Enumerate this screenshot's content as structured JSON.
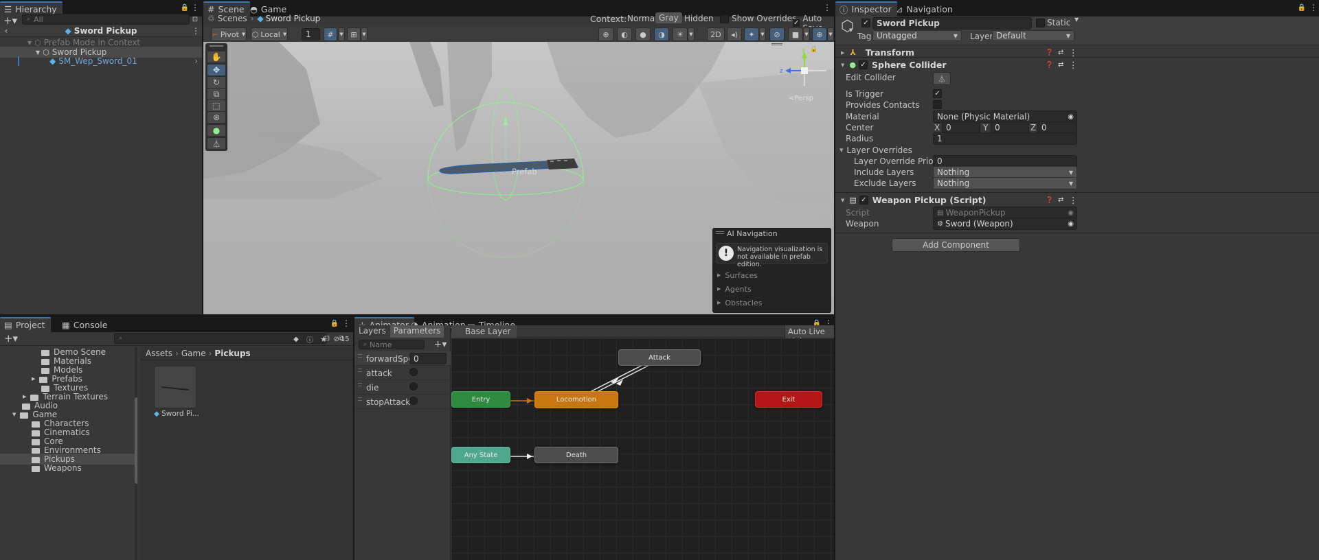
{
  "hierarchy": {
    "tab_label": "Hierarchy",
    "search_placeholder": "All",
    "title": "Sword Pickup",
    "items": [
      {
        "label": "Prefab Mode in Context"
      },
      {
        "label": "Sword Pickup"
      },
      {
        "label": "SM_Wep_Sword_01"
      }
    ]
  },
  "scene": {
    "tabs": [
      "Scene",
      "Game"
    ],
    "breadcrumb": [
      "Scenes",
      "Sword Pickup"
    ],
    "context_label": "Context:",
    "context_options": [
      "Normal",
      "Gray",
      "Hidden"
    ],
    "context_selected": "Gray",
    "show_overrides": "Show Overrides",
    "auto_save": "Auto Save",
    "pivot": "Pivot",
    "local": "Local",
    "grid_value": "1",
    "view_2d": "2D",
    "prefab_watermark": "Prefab",
    "persp_label": "<Persp",
    "ai_nav": {
      "title": "AI Navigation",
      "message": "Navigation visualization is not available in prefab edition.",
      "items": [
        "Surfaces",
        "Agents",
        "Obstacles"
      ]
    }
  },
  "project": {
    "tabs": [
      "Project",
      "Console"
    ],
    "tree": [
      {
        "label": "Demo Scene",
        "indent": 3
      },
      {
        "label": "Materials",
        "indent": 3
      },
      {
        "label": "Models",
        "indent": 3
      },
      {
        "label": "Prefabs",
        "indent": 3
      },
      {
        "label": "Textures",
        "indent": 3
      },
      {
        "label": "Terrain Textures",
        "indent": 2
      },
      {
        "label": "Audio",
        "indent": 1
      },
      {
        "label": "Game",
        "indent": 1
      },
      {
        "label": "Characters",
        "indent": 2
      },
      {
        "label": "Cinematics",
        "indent": 2
      },
      {
        "label": "Core",
        "indent": 2
      },
      {
        "label": "Environments",
        "indent": 2
      },
      {
        "label": "Pickups",
        "indent": 2
      },
      {
        "label": "Weapons",
        "indent": 2
      }
    ],
    "breadcrumb": [
      "Assets",
      "Game",
      "Pickups"
    ],
    "hidden_count": "15",
    "asset_label": "Sword Pi..."
  },
  "animator": {
    "tabs": [
      "Animator",
      "Animation",
      "Timeline"
    ],
    "sub_tabs": [
      "Layers",
      "Parameters"
    ],
    "layer_name": "Base Layer",
    "auto_live_link": "Auto Live Link",
    "search_placeholder": "Name",
    "parameters": [
      {
        "name": "forwardSpee",
        "value": "0"
      },
      {
        "name": "attack",
        "value": ""
      },
      {
        "name": "die",
        "value": ""
      },
      {
        "name": "stopAttack",
        "value": ""
      }
    ],
    "nodes": {
      "attack": "Attack",
      "entry": "Entry",
      "locomotion": "Locomotion",
      "exit": "Exit",
      "any_state": "Any State",
      "death": "Death"
    }
  },
  "inspector": {
    "tabs": [
      "Inspector",
      "Navigation"
    ],
    "object_name": "Sword Pickup",
    "static_label": "Static",
    "tag_label": "Tag",
    "tag_value": "Untagged",
    "layer_label": "Layer",
    "layer_value": "Default",
    "transform": "Transform",
    "sphere_collider": {
      "title": "Sphere Collider",
      "edit_collider": "Edit Collider",
      "is_trigger": "Is Trigger",
      "provides_contacts": "Provides Contacts",
      "material_label": "Material",
      "material_value": "None (Physic Material)",
      "center_label": "Center",
      "center": {
        "x": "0",
        "y": "0",
        "z": "0"
      },
      "radius_label": "Radius",
      "radius_value": "1",
      "layer_overrides": "Layer Overrides",
      "override_priority_label": "Layer Override Priority",
      "override_priority_value": "0",
      "include_layers_label": "Include Layers",
      "include_layers_value": "Nothing",
      "exclude_layers_label": "Exclude Layers",
      "exclude_layers_value": "Nothing"
    },
    "weapon_pickup": {
      "title": "Weapon Pickup (Script)",
      "script_label": "Script",
      "script_value": "WeaponPickup",
      "weapon_label": "Weapon",
      "weapon_value": "Sword (Weapon)"
    },
    "add_component": "Add Component"
  },
  "colors": {
    "accent": "#3a79bb",
    "entry": "#2d8a3e",
    "locomotion": "#c8760f",
    "exit": "#b41616",
    "any_state": "#4fa88e",
    "collider": "#8ef08e"
  }
}
